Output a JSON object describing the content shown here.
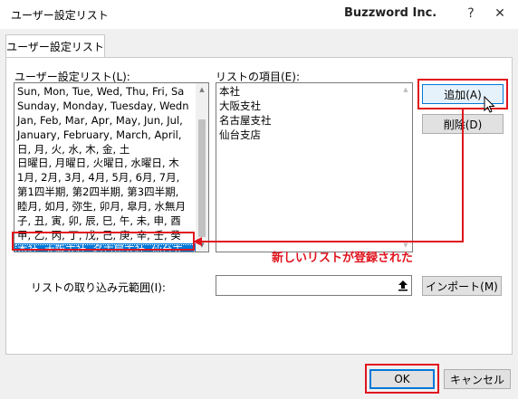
{
  "window": {
    "title": "ユーザー設定リスト",
    "brand": "Buzzword Inc.",
    "help": "?",
    "close": "✕"
  },
  "tab": {
    "label": "ユーザー設定リスト"
  },
  "custom_lists": {
    "label": "ユーザー設定リスト(L):",
    "items": [
      "Sun, Mon, Tue, Wed, Thu, Fri, Sa",
      "Sunday, Monday, Tuesday, Wedn",
      "Jan, Feb, Mar, Apr, May, Jun, Jul,",
      "January, February, March, April,",
      "日, 月, 火, 水, 木, 金, 土",
      "日曜日, 月曜日, 火曜日, 水曜日, 木",
      "1月, 2月, 3月, 4月, 5月, 6月, 7月,",
      "第1四半期, 第2四半期, 第3四半期,",
      "睦月, 如月, 弥生, 卯月, 皐月, 水無月",
      "子, 丑, 寅, 卯, 辰, 巳, 午, 未, 申, 酉",
      "甲, 乙, 丙, 丁, 戊, 己, 庚, 辛, 壬, 癸",
      "本社, 大阪支社, 名古屋支社, 仙台支"
    ],
    "selected_index": 11
  },
  "list_entries": {
    "label": "リストの項目(E):",
    "items": [
      "本社",
      "大阪支社",
      "名古屋支社",
      "仙台支店"
    ]
  },
  "buttons": {
    "add": "追加(A)",
    "delete": "削除(D)",
    "import": "インポート(M)",
    "ok": "OK",
    "cancel": "キャンセル"
  },
  "import_range": {
    "label": "リストの取り込み元範囲(I):",
    "value": "",
    "icon": "collapse-dialog-icon"
  },
  "annotation": {
    "text": "新しいリストが登録された",
    "color": "#e0141e"
  },
  "colors": {
    "selection": "#0078d7",
    "accent": "#e0141e"
  }
}
